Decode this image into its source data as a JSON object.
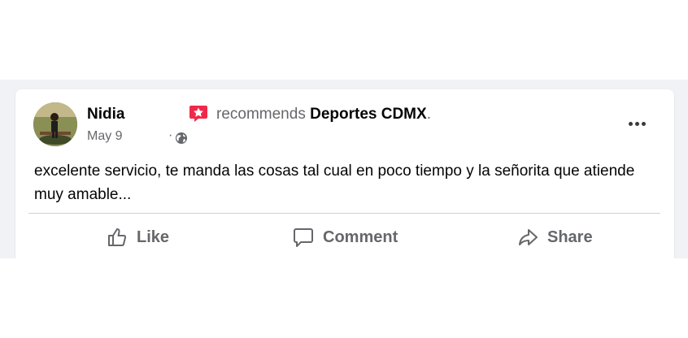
{
  "post": {
    "author": "Nidia",
    "recommends_text": "recommends",
    "page_name": "Deportes CDMX",
    "page_suffix": ".",
    "date": "May 9",
    "separator": "·",
    "audience_icon": "globe-icon",
    "badge_icon": "recommendation-star-icon",
    "text": "excelente servicio, te manda las cosas tal cual en poco tiempo y la señorita que atiende muy amable..."
  },
  "actions": {
    "like_label": "Like",
    "comment_label": "Comment",
    "share_label": "Share"
  },
  "colors": {
    "badge": "#f02849",
    "secondary_text": "#65676b",
    "primary_text": "#050505",
    "feed_background": "#f0f2f5"
  }
}
